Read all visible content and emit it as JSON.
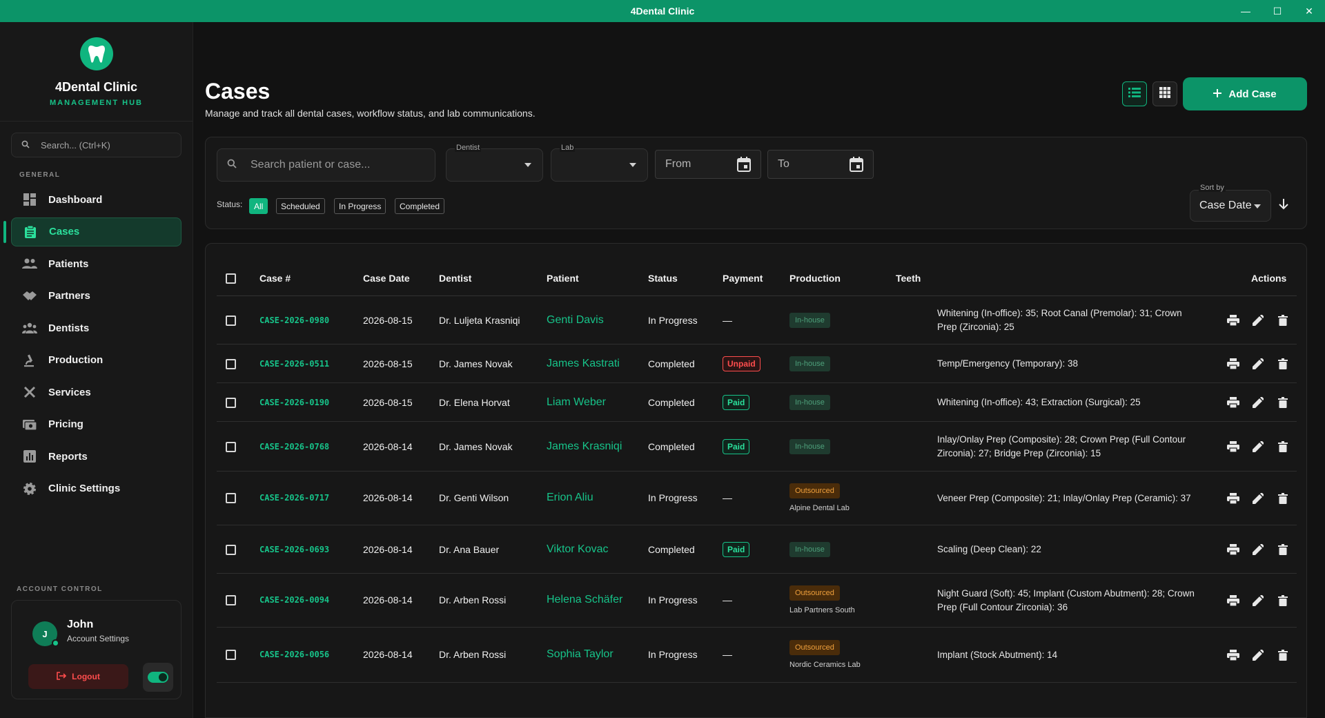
{
  "window": {
    "title": "4Dental Clinic"
  },
  "brand": {
    "name": "4Dental Clinic",
    "subtitle": "MANAGEMENT HUB"
  },
  "sidebar": {
    "search_placeholder": "Search... (Ctrl+K)",
    "section_label": "GENERAL",
    "items": [
      {
        "label": "Dashboard",
        "icon": "dashboard-icon",
        "active": false
      },
      {
        "label": "Cases",
        "icon": "clipboard-icon",
        "active": true
      },
      {
        "label": "Patients",
        "icon": "people-icon",
        "active": false
      },
      {
        "label": "Partners",
        "icon": "handshake-icon",
        "active": false
      },
      {
        "label": "Dentists",
        "icon": "group-icon",
        "active": false
      },
      {
        "label": "Production",
        "icon": "microscope-icon",
        "active": false
      },
      {
        "label": "Services",
        "icon": "tools-icon",
        "active": false
      },
      {
        "label": "Pricing",
        "icon": "money-icon",
        "active": false
      },
      {
        "label": "Reports",
        "icon": "bar-chart-icon",
        "active": false
      },
      {
        "label": "Clinic Settings",
        "icon": "gear-icon",
        "active": false
      }
    ]
  },
  "account": {
    "section_label": "ACCOUNT CONTROL",
    "avatar_initial": "J",
    "name": "John",
    "settings_label": "Account Settings",
    "logout_label": "Logout",
    "theme_toggle_on": true
  },
  "page": {
    "title": "Cases",
    "subtitle": "Manage and track all dental cases, workflow status, and lab communications.",
    "add_button": "Add Case"
  },
  "filters": {
    "search_placeholder": "Search patient or case...",
    "dentist_label": "Dentist",
    "dentist_value": "",
    "lab_label": "Lab",
    "lab_value": "",
    "from_placeholder": "From",
    "to_placeholder": "To",
    "status_label": "Status:",
    "status_chips": [
      "All",
      "Scheduled",
      "In Progress",
      "Completed"
    ],
    "active_status": "All",
    "sort_label": "Sort by",
    "sort_value": "Case Date"
  },
  "table": {
    "columns": [
      "Case #",
      "Case Date",
      "Dentist",
      "Patient",
      "Status",
      "Payment",
      "Production",
      "Teeth",
      "Actions"
    ],
    "rows": [
      {
        "case": "CASE-2026-0980",
        "date": "2026-08-15",
        "dentist": "Dr. Luljeta Krasniqi",
        "patient": "Genti Davis",
        "status": "In Progress",
        "payment": "—",
        "production": "In-house",
        "lab": "",
        "teeth": "Whitening (In-office): 35; Root Canal (Premolar): 31; Crown Prep (Zirconia): 25"
      },
      {
        "case": "CASE-2026-0511",
        "date": "2026-08-15",
        "dentist": "Dr. James Novak",
        "patient": "James Kastrati",
        "status": "Completed",
        "payment": "Unpaid",
        "production": "In-house",
        "lab": "",
        "teeth": "Temp/Emergency (Temporary): 38"
      },
      {
        "case": "CASE-2026-0190",
        "date": "2026-08-15",
        "dentist": "Dr. Elena Horvat",
        "patient": "Liam Weber",
        "status": "Completed",
        "payment": "Paid",
        "production": "In-house",
        "lab": "",
        "teeth": "Whitening (In-office): 43; Extraction (Surgical): 25"
      },
      {
        "case": "CASE-2026-0768",
        "date": "2026-08-14",
        "dentist": "Dr. James Novak",
        "patient": "James Krasniqi",
        "status": "Completed",
        "payment": "Paid",
        "production": "In-house",
        "lab": "",
        "teeth": "Inlay/Onlay Prep (Composite): 28; Crown Prep (Full Contour Zirconia): 27; Bridge Prep (Zirconia): 15"
      },
      {
        "case": "CASE-2026-0717",
        "date": "2026-08-14",
        "dentist": "Dr. Genti Wilson",
        "patient": "Erion Aliu",
        "status": "In Progress",
        "payment": "—",
        "production": "Outsourced",
        "lab": "Alpine Dental Lab",
        "teeth": "Veneer Prep (Composite): 21; Inlay/Onlay Prep (Ceramic): 37"
      },
      {
        "case": "CASE-2026-0693",
        "date": "2026-08-14",
        "dentist": "Dr. Ana Bauer",
        "patient": "Viktor Kovac",
        "status": "Completed",
        "payment": "Paid",
        "production": "In-house",
        "lab": "",
        "teeth": "Scaling (Deep Clean): 22"
      },
      {
        "case": "CASE-2026-0094",
        "date": "2026-08-14",
        "dentist": "Dr. Arben Rossi",
        "patient": "Helena Schäfer",
        "status": "In Progress",
        "payment": "—",
        "production": "Outsourced",
        "lab": "Lab Partners South",
        "teeth": "Night Guard (Soft): 45; Implant (Custom Abutment): 28; Crown Prep (Full Contour Zirconia): 36"
      },
      {
        "case": "CASE-2026-0056",
        "date": "2026-08-14",
        "dentist": "Dr. Arben Rossi",
        "patient": "Sophia Taylor",
        "status": "In Progress",
        "payment": "—",
        "production": "Outsourced",
        "lab": "Nordic Ceramics Lab",
        "teeth": "Implant (Stock Abutment): 14"
      }
    ]
  },
  "colors": {
    "accent": "#10b57f",
    "titlebar": "#0c9468",
    "background": "#121212",
    "unpaid": "#ff4d4d",
    "outsourced": "#f0a03c"
  }
}
